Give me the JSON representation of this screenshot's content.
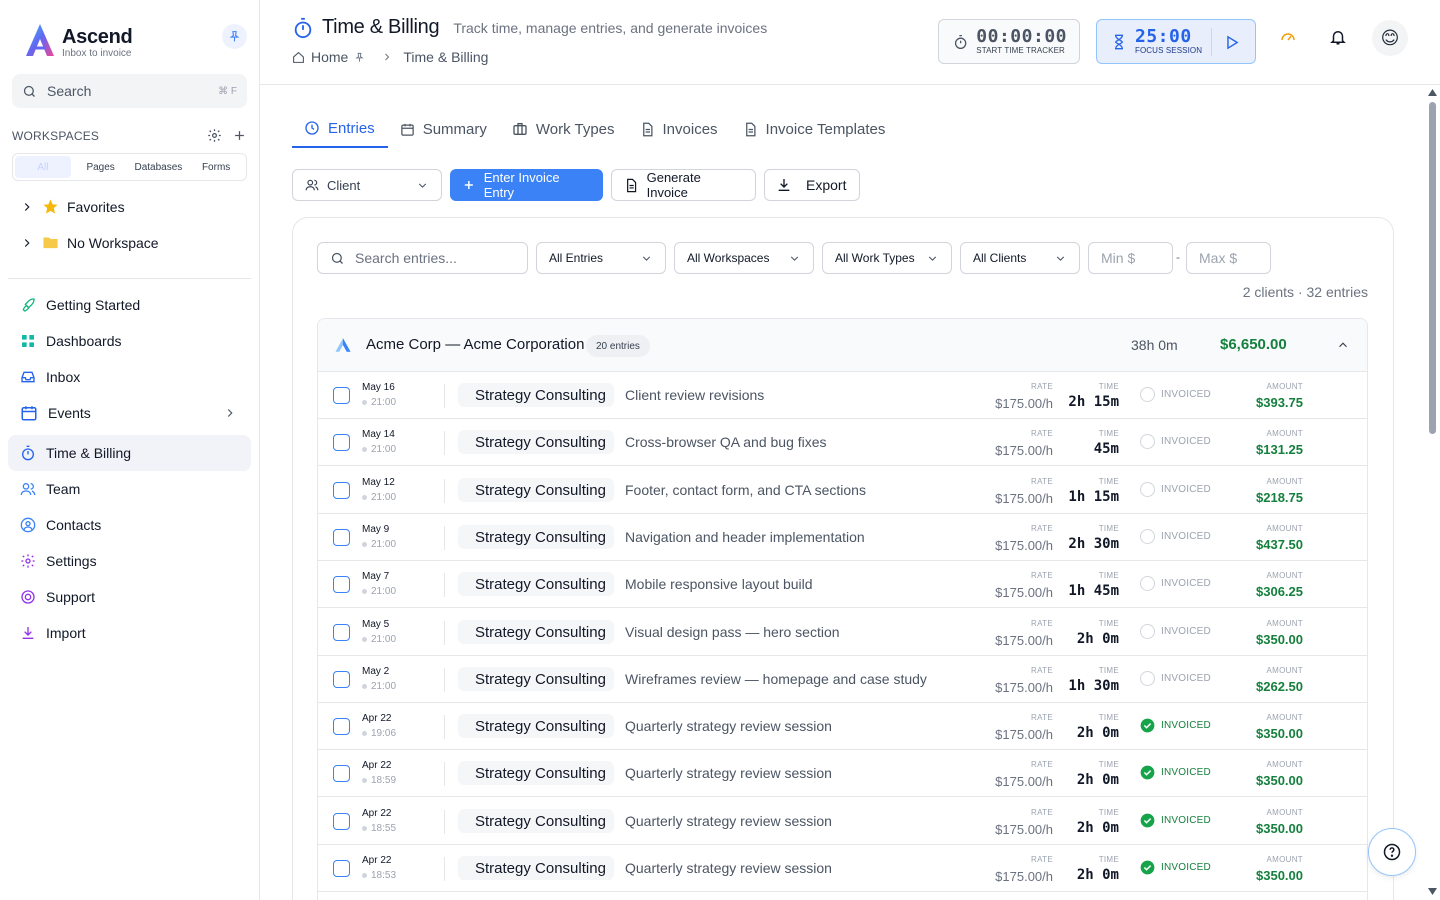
{
  "brand": {
    "name": "Ascend",
    "tagline": "Inbox to invoice"
  },
  "sidebar": {
    "search_label": "Search",
    "search_shortcut": "⌘ F",
    "workspaces_title": "WORKSPACES",
    "filter_tabs": [
      "All",
      "Pages",
      "Databases",
      "Forms"
    ],
    "tree": [
      {
        "label": "Favorites",
        "icon": "star-icon"
      },
      {
        "label": "No Workspace",
        "icon": "folder-icon"
      }
    ],
    "nav": [
      {
        "label": "Getting Started",
        "icon": "rocket-icon"
      },
      {
        "label": "Dashboards",
        "icon": "grid-icon"
      },
      {
        "label": "Inbox",
        "icon": "inbox-icon"
      },
      {
        "label": "Events",
        "icon": "calendar-icon"
      },
      {
        "label": "Time & Billing",
        "icon": "stopwatch-icon",
        "active": true
      },
      {
        "label": "Team",
        "icon": "users-icon"
      },
      {
        "label": "Contacts",
        "icon": "contact-icon"
      },
      {
        "label": "Settings",
        "icon": "gear-icon"
      },
      {
        "label": "Support",
        "icon": "lifebuoy-icon"
      },
      {
        "label": "Import",
        "icon": "download-icon"
      }
    ]
  },
  "header": {
    "title": "Time & Billing",
    "subtitle": "Track time, manage entries, and generate invoices",
    "breadcrumb": [
      "Home",
      "Time & Billing"
    ],
    "tracker": {
      "time": "00:00:00",
      "label": "START TIME TRACKER"
    },
    "focus": {
      "time": "25:00",
      "label": "FOCUS SESSION"
    }
  },
  "tabs": [
    "Entries",
    "Summary",
    "Work Types",
    "Invoices",
    "Invoice Templates"
  ],
  "toolbar": {
    "client": "Client",
    "enter": "Enter Invoice Entry",
    "generate": "Generate Invoice",
    "export": "Export"
  },
  "filters": {
    "search_placeholder": "Search entries...",
    "entries": "All Entries",
    "workspaces": "All Workspaces",
    "work_types": "All Work Types",
    "clients": "All Clients",
    "min": "Min $",
    "max": "Max $",
    "dash": "-",
    "counts": "2 clients · 32 entries"
  },
  "group": {
    "name": "Acme Corp — Acme Corporation",
    "badge": "20 entries",
    "hours": "38h 0m",
    "total": "$6,650.00"
  },
  "labels": {
    "rate": "RATE",
    "time": "TIME",
    "amount": "AMOUNT",
    "invoiced": "INVOICED"
  },
  "entries": [
    {
      "date": "May 16",
      "time": "21:00",
      "work_type": "Strategy Consulting",
      "desc": "Client review revisions",
      "rate": "$175.00/h",
      "duration": "2h 15m",
      "invoiced": false,
      "amount": "$393.75"
    },
    {
      "date": "May 14",
      "time": "21:00",
      "work_type": "Strategy Consulting",
      "desc": "Cross-browser QA and bug fixes",
      "rate": "$175.00/h",
      "duration": "45m",
      "invoiced": false,
      "amount": "$131.25"
    },
    {
      "date": "May 12",
      "time": "21:00",
      "work_type": "Strategy Consulting",
      "desc": "Footer, contact form, and CTA sections",
      "rate": "$175.00/h",
      "duration": "1h 15m",
      "invoiced": false,
      "amount": "$218.75"
    },
    {
      "date": "May 9",
      "time": "21:00",
      "work_type": "Strategy Consulting",
      "desc": "Navigation and header implementation",
      "rate": "$175.00/h",
      "duration": "2h 30m",
      "invoiced": false,
      "amount": "$437.50"
    },
    {
      "date": "May 7",
      "time": "21:00",
      "work_type": "Strategy Consulting",
      "desc": "Mobile responsive layout build",
      "rate": "$175.00/h",
      "duration": "1h 45m",
      "invoiced": false,
      "amount": "$306.25"
    },
    {
      "date": "May 5",
      "time": "21:00",
      "work_type": "Strategy Consulting",
      "desc": "Visual design pass — hero section",
      "rate": "$175.00/h",
      "duration": "2h 0m",
      "invoiced": false,
      "amount": "$350.00"
    },
    {
      "date": "May 2",
      "time": "21:00",
      "work_type": "Strategy Consulting",
      "desc": "Wireframes review — homepage and case study",
      "rate": "$175.00/h",
      "duration": "1h 30m",
      "invoiced": false,
      "amount": "$262.50"
    },
    {
      "date": "Apr 22",
      "time": "19:06",
      "work_type": "Strategy Consulting",
      "desc": "Quarterly strategy review session",
      "rate": "$175.00/h",
      "duration": "2h 0m",
      "invoiced": true,
      "amount": "$350.00"
    },
    {
      "date": "Apr 22",
      "time": "18:59",
      "work_type": "Strategy Consulting",
      "desc": "Quarterly strategy review session",
      "rate": "$175.00/h",
      "duration": "2h 0m",
      "invoiced": true,
      "amount": "$350.00"
    },
    {
      "date": "Apr 22",
      "time": "18:55",
      "work_type": "Strategy Consulting",
      "desc": "Quarterly strategy review session",
      "rate": "$175.00/h",
      "duration": "2h 0m",
      "invoiced": true,
      "amount": "$350.00"
    },
    {
      "date": "Apr 22",
      "time": "18:53",
      "work_type": "Strategy Consulting",
      "desc": "Quarterly strategy review session",
      "rate": "$175.00/h",
      "duration": "2h 0m",
      "invoiced": true,
      "amount": "$350.00"
    }
  ],
  "colors": {
    "accent": "#2563eb",
    "success": "#15803d",
    "brand_gradient": [
      "#3b82f6",
      "#a855f7"
    ]
  }
}
